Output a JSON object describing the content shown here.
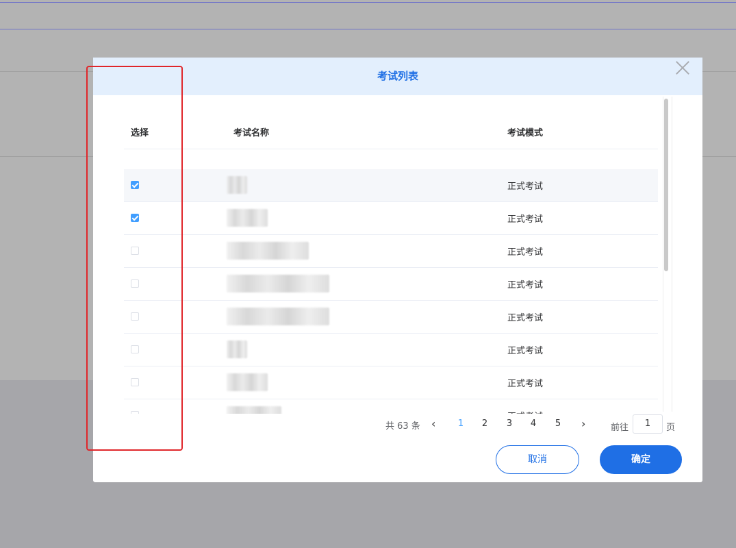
{
  "dialog": {
    "title": "考试列表",
    "table": {
      "headers": {
        "select": "选择",
        "name": "考试名称",
        "mode": "考试模式"
      },
      "rows": [
        {
          "checked": true,
          "mode": "正式考试",
          "highlighted": true
        },
        {
          "checked": true,
          "mode": "正式考试",
          "highlighted": false
        },
        {
          "checked": false,
          "mode": "正式考试",
          "highlighted": false
        },
        {
          "checked": false,
          "mode": "正式考试",
          "highlighted": false
        },
        {
          "checked": false,
          "mode": "正式考试",
          "highlighted": false
        },
        {
          "checked": false,
          "mode": "正式考试",
          "highlighted": false
        },
        {
          "checked": false,
          "mode": "正式考试",
          "highlighted": false
        },
        {
          "checked": false,
          "mode": "正式考试",
          "highlighted": false
        }
      ]
    },
    "pagination": {
      "total": "共 63 条",
      "pages": [
        "1",
        "2",
        "3",
        "4",
        "5"
      ],
      "current_page": "1",
      "goto_label": "前往",
      "goto_value": "1",
      "page_unit": "页",
      "prev_icon": "chevron-left-icon",
      "next_icon": "chevron-right-icon"
    },
    "buttons": {
      "cancel": "取消",
      "confirm": "确定"
    },
    "close_icon": "close-icon"
  },
  "colors": {
    "accent": "#1f6fe5",
    "checkbox": "#409eff",
    "header_bg": "#e3effd",
    "annotation": "#e0262a"
  }
}
